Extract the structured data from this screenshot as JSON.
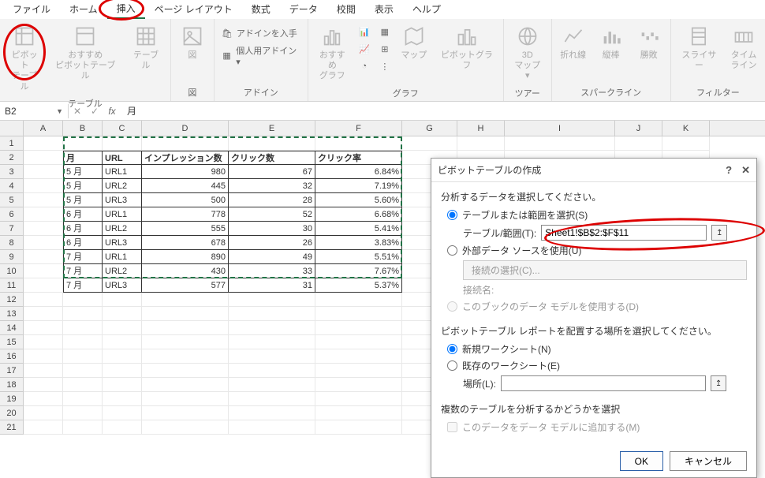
{
  "ribbon": {
    "tabs": [
      "ファイル",
      "ホーム",
      "挿入",
      "ページ レイアウト",
      "数式",
      "データ",
      "校閲",
      "表示",
      "ヘルプ"
    ],
    "active_tab_index": 2,
    "groups": {
      "tables": {
        "label": "テーブル",
        "pivot": "ピボット\nテーブル",
        "rec_pivot": "おすすめ\nピボットテーブル",
        "table": "テーブル"
      },
      "illust": {
        "label": "図",
        "pic": "図"
      },
      "addins": {
        "label": "アドイン",
        "get": "アドインを入手",
        "personal": "個人用アドイン ▾"
      },
      "charts": {
        "label": "グラフ",
        "rec": "おすすめ\nグラフ",
        "pivot_chart": "ピボットグラフ",
        "maps": "マップ"
      },
      "tours": {
        "label": "ツアー",
        "map3d": "3D\nマップ ▾"
      },
      "sparklines": {
        "label": "スパークライン",
        "line": "折れ線",
        "col": "縦棒",
        "winloss": "勝敗"
      },
      "filters": {
        "label": "フィルター",
        "slicer": "スライサー",
        "timeline": "タイム\nライン"
      }
    }
  },
  "formula_bar": {
    "name_box": "B2",
    "value": "月"
  },
  "columns": [
    "A",
    "B",
    "C",
    "D",
    "E",
    "F",
    "G",
    "H",
    "I",
    "J",
    "K"
  ],
  "table": {
    "headers": [
      "月",
      "URL",
      "インプレッション数",
      "クリック数",
      "クリック率"
    ],
    "rows": [
      [
        "5 月",
        "URL1",
        "980",
        "67",
        "6.84%"
      ],
      [
        "5 月",
        "URL2",
        "445",
        "32",
        "7.19%"
      ],
      [
        "5 月",
        "URL3",
        "500",
        "28",
        "5.60%"
      ],
      [
        "6 月",
        "URL1",
        "778",
        "52",
        "6.68%"
      ],
      [
        "6 月",
        "URL2",
        "555",
        "30",
        "5.41%"
      ],
      [
        "6 月",
        "URL3",
        "678",
        "26",
        "3.83%"
      ],
      [
        "7 月",
        "URL1",
        "890",
        "49",
        "5.51%"
      ],
      [
        "7 月",
        "URL2",
        "430",
        "33",
        "7.67%"
      ],
      [
        "7 月",
        "URL3",
        "577",
        "31",
        "5.37%"
      ]
    ]
  },
  "dialog": {
    "title": "ピボットテーブルの作成",
    "section1": "分析するデータを選択してください。",
    "opt_table_range": "テーブルまたは範囲を選択(S)",
    "label_range": "テーブル/範囲(T):",
    "range_value": "Sheet1!$B$2:$F$11",
    "opt_external": "外部データ ソースを使用(U)",
    "btn_conn": "接続の選択(C)...",
    "label_conn_name": "接続名:",
    "opt_datamodel": "このブックのデータ モデルを使用する(D)",
    "section2": "ピボットテーブル レポートを配置する場所を選択してください。",
    "opt_new_ws": "新規ワークシート(N)",
    "opt_existing_ws": "既存のワークシート(E)",
    "label_location": "場所(L):",
    "section3": "複数のテーブルを分析するかどうかを選択",
    "chk_add_datamodel": "このデータをデータ モデルに追加する(M)",
    "btn_ok": "OK",
    "btn_cancel": "キャンセル"
  },
  "chart_data": {
    "type": "table",
    "title": "",
    "columns": [
      "月",
      "URL",
      "インプレッション数",
      "クリック数",
      "クリック率"
    ],
    "rows": [
      [
        "5 月",
        "URL1",
        980,
        67,
        "6.84%"
      ],
      [
        "5 月",
        "URL2",
        445,
        32,
        "7.19%"
      ],
      [
        "5 月",
        "URL3",
        500,
        28,
        "5.60%"
      ],
      [
        "6 月",
        "URL1",
        778,
        52,
        "6.68%"
      ],
      [
        "6 月",
        "URL2",
        555,
        30,
        "5.41%"
      ],
      [
        "6 月",
        "URL3",
        678,
        26,
        "3.83%"
      ],
      [
        "7 月",
        "URL1",
        890,
        49,
        "5.51%"
      ],
      [
        "7 月",
        "URL2",
        430,
        33,
        "7.67%"
      ],
      [
        "7 月",
        "URL3",
        577,
        31,
        "5.37%"
      ]
    ]
  }
}
